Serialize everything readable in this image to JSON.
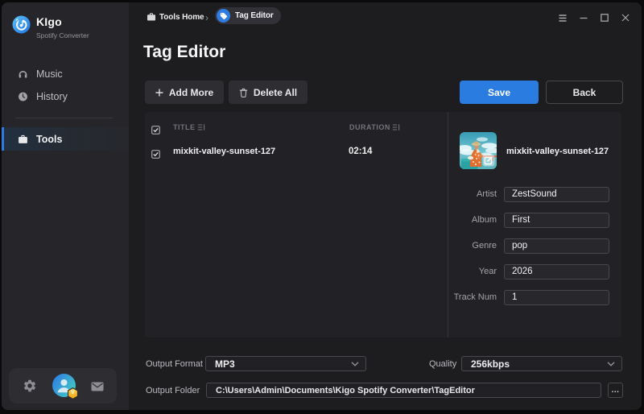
{
  "app": {
    "name": "KIgo",
    "subtitle": "Spotify Converter"
  },
  "colors": {
    "accent": "#2b7ce1",
    "badge": "#f5a81c",
    "sidebar_bg": "#26262a",
    "main_bg": "#1d1d20",
    "panel_bg": "#222226"
  },
  "sidebar": {
    "items": [
      {
        "label": "Music",
        "icon": "headphones-icon",
        "selected": false
      },
      {
        "label": "History",
        "icon": "clock-icon",
        "selected": false
      },
      {
        "label": "Tools",
        "icon": "briefcase-icon",
        "selected": true
      }
    ],
    "dock": {
      "icons": [
        "gear-icon",
        "account-avatar",
        "mail-icon"
      ],
      "vip_badge": "V"
    }
  },
  "topbar": {
    "breadcrumb_home": "Tools Home",
    "breadcrumb_separator": "›",
    "breadcrumb_current": "Tag Editor",
    "window_controls": [
      "menu",
      "minimize",
      "maximize",
      "close"
    ]
  },
  "page": {
    "title": "Tag Editor"
  },
  "toolbar": {
    "add_more_label": "Add More",
    "delete_all_label": "Delete All",
    "save_label": "Save",
    "back_label": "Back"
  },
  "table": {
    "columns": [
      "TITLE",
      "DURATION"
    ],
    "rows": [
      {
        "checked": true,
        "title": "mixkit-valley-sunset-127",
        "duration": "02:14"
      }
    ],
    "header_checked": true
  },
  "details": {
    "track_title": "mixkit-valley-sunset-127",
    "artwork": "beach-photo-thumbnail",
    "fields": [
      {
        "label": "Artist",
        "value": "ZestSound"
      },
      {
        "label": "Album",
        "value": "First"
      },
      {
        "label": "Genre",
        "value": "pop"
      },
      {
        "label": "Year",
        "value": "2026"
      },
      {
        "label": "Track Num",
        "value": "1"
      }
    ]
  },
  "output": {
    "format_label": "Output Format",
    "format_value": "MP3",
    "quality_label": "Quality",
    "quality_value": "256kbps",
    "folder_label": "Output Folder",
    "folder_value": "C:\\Users\\Admin\\Documents\\Kigo Spotify Converter\\TagEditor",
    "browse_label": "..."
  }
}
